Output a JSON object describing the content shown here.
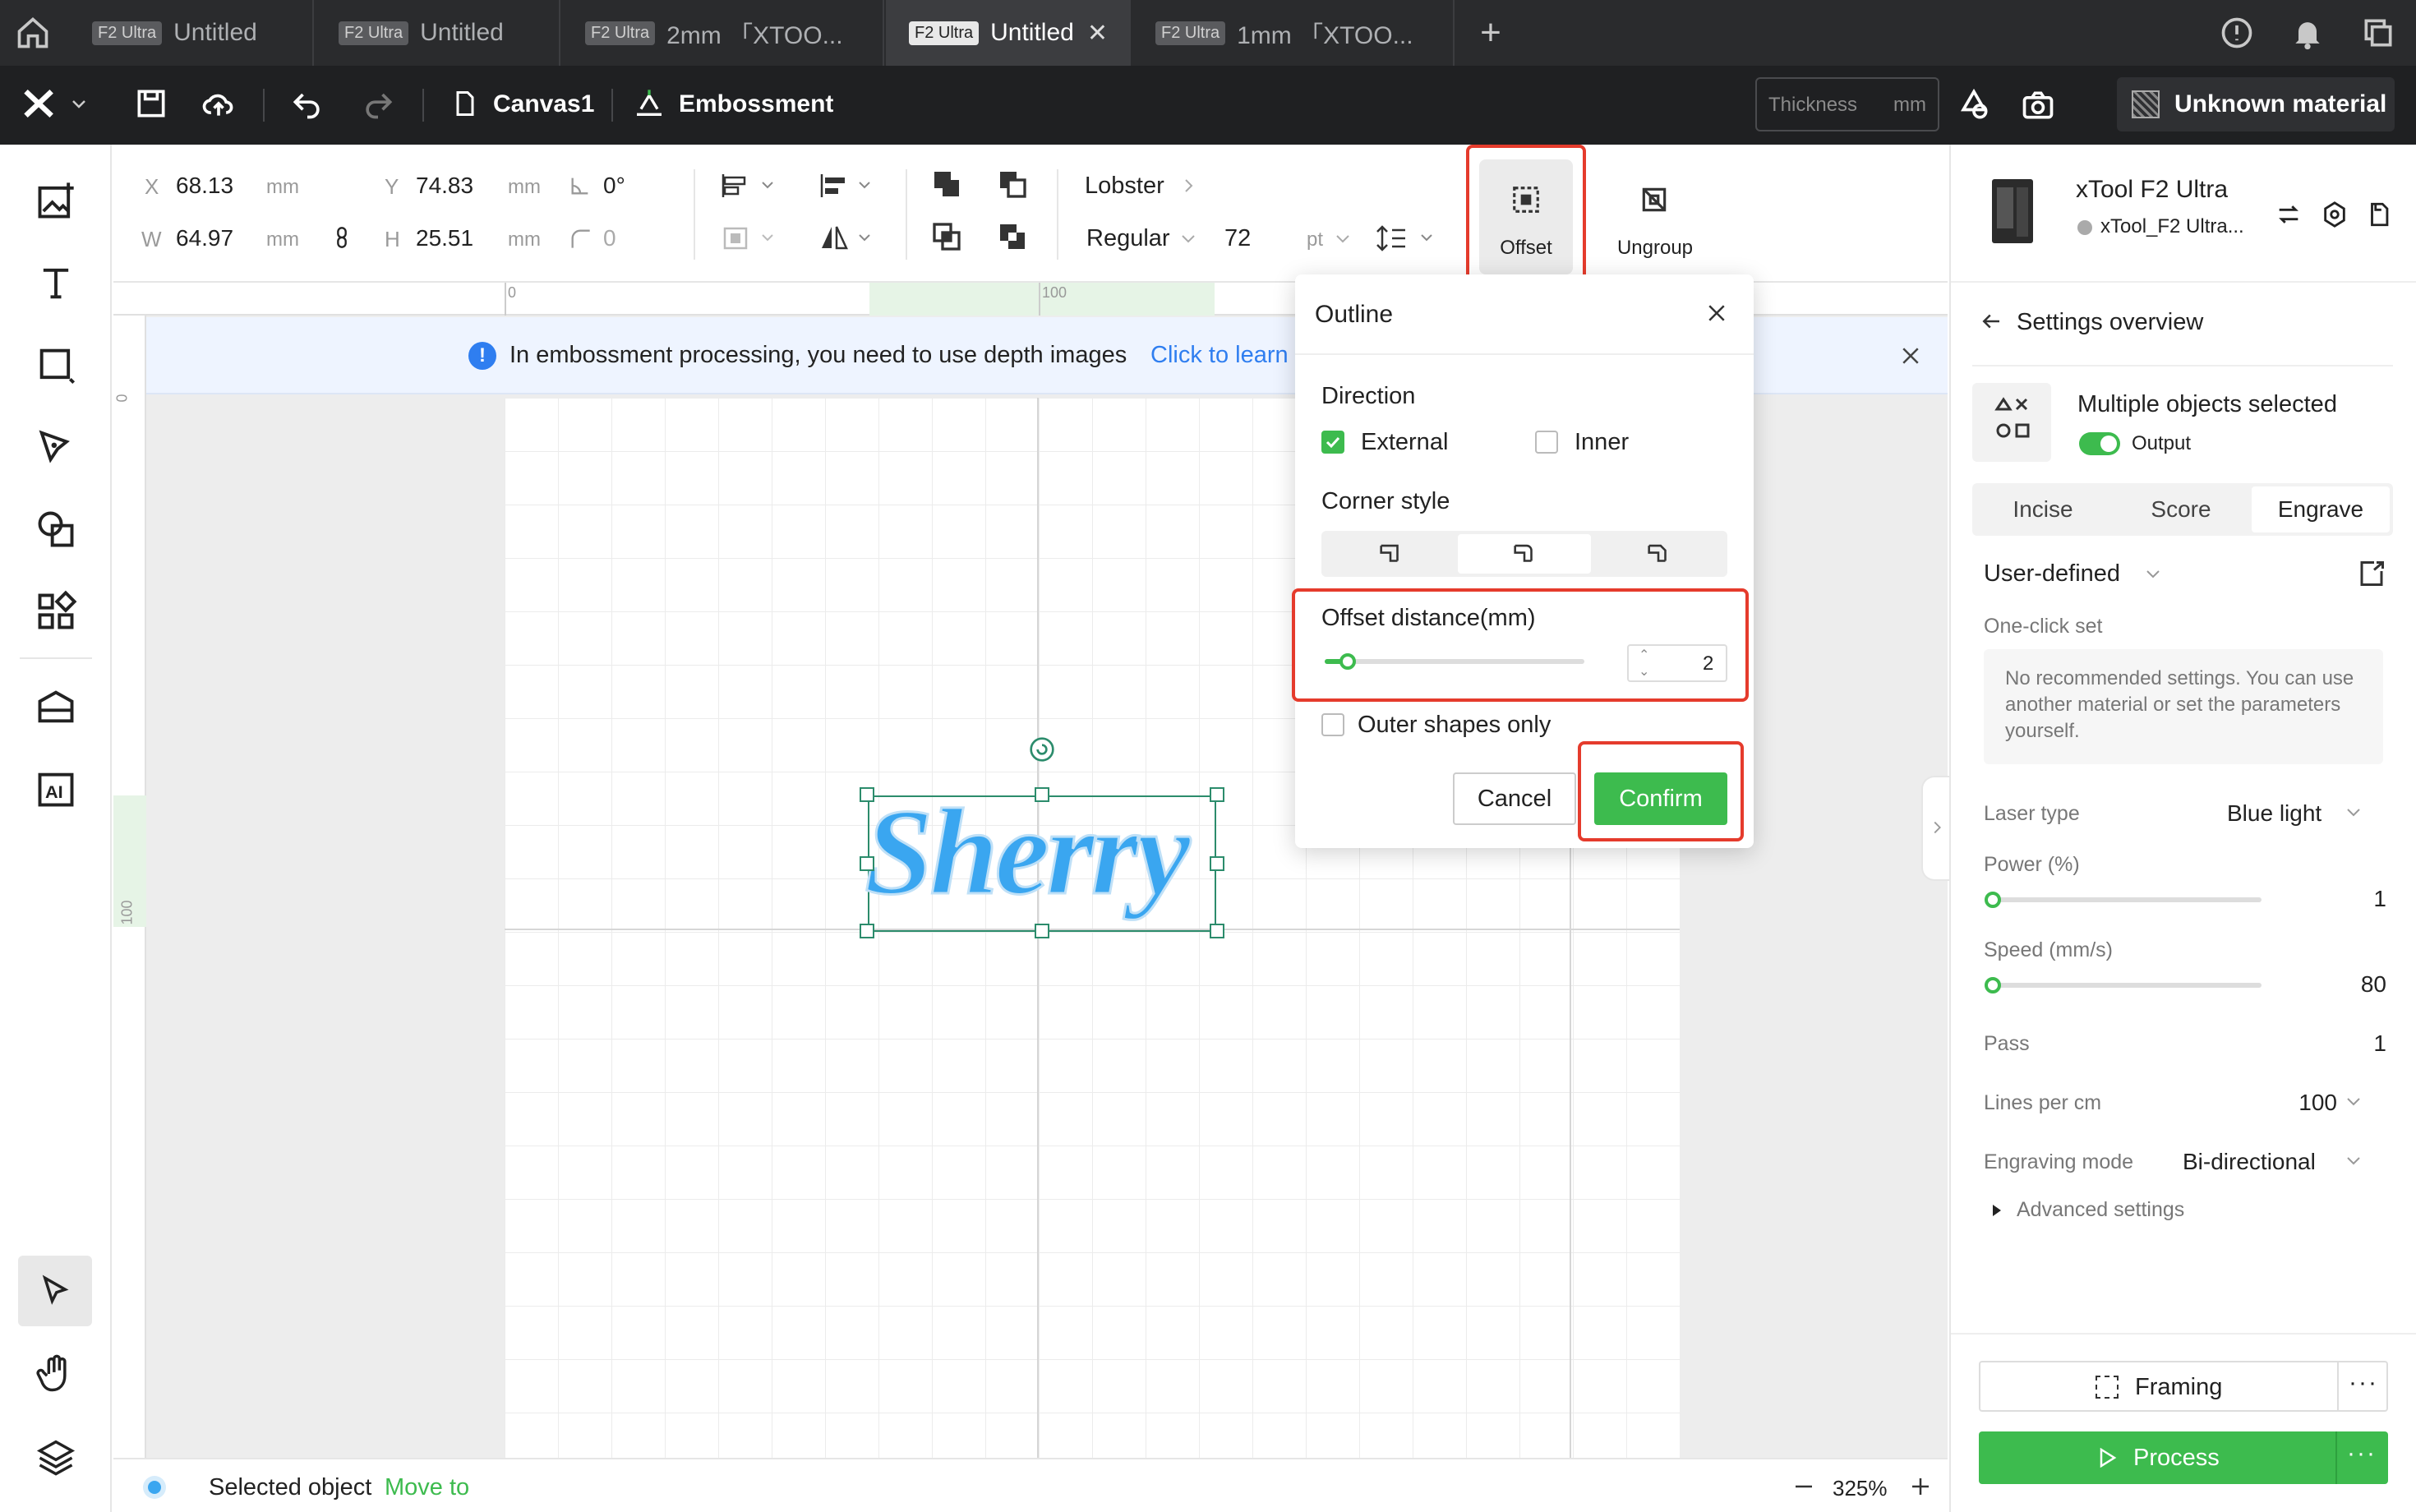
{
  "tabs": [
    {
      "badge": "F2 Ultra",
      "title": "Untitled"
    },
    {
      "badge": "F2 Ultra",
      "title": "Untitled"
    },
    {
      "badge": "F2 Ultra",
      "title": "2mm 「XTOO..."
    },
    {
      "badge": "F2 Ultra",
      "title": "Untitled"
    },
    {
      "badge": "F2 Ultra",
      "title": "1mm 「XTOO..."
    }
  ],
  "toolbar": {
    "canvas_name": "Canvas1",
    "mode": "Embossment",
    "thickness_placeholder": "Thickness",
    "thickness_unit": "mm",
    "material": "Unknown material"
  },
  "props": {
    "x_label": "X",
    "x": "68.13",
    "y_label": "Y",
    "y": "74.83",
    "w_label": "W",
    "w": "64.97",
    "h_label": "H",
    "h": "25.51",
    "unit": "mm",
    "rotation": "0°",
    "radius": "0",
    "font": "Lobster",
    "style": "Regular",
    "size": "72",
    "size_unit": "pt",
    "offset_label": "Offset",
    "ungroup_label": "Ungroup"
  },
  "ruler": {
    "top_0": "0",
    "top_100": "100",
    "left_0": "0",
    "left_100": "100"
  },
  "banner": {
    "text": "In embossment processing, you need to use depth images",
    "link": "Click to learn"
  },
  "canvas": {
    "text": "Sherry"
  },
  "dialog": {
    "title": "Outline",
    "direction_label": "Direction",
    "external": "External",
    "inner": "Inner",
    "external_checked": true,
    "inner_checked": false,
    "corner_label": "Corner style",
    "offset_label": "Offset distance(mm)",
    "offset_value": "2",
    "offset_fraction": 0.09,
    "outer_only": "Outer shapes only",
    "cancel": "Cancel",
    "confirm": "Confirm"
  },
  "status": {
    "selected": "Selected object",
    "move": "Move to",
    "zoom": "325%"
  },
  "right": {
    "device": "xTool F2 Ultra",
    "device_sub": "xTool_F2 Ultra...",
    "overview": "Settings overview",
    "multi": "Multiple objects selected",
    "output": "Output",
    "tabs": [
      "Incise",
      "Score",
      "Engrave"
    ],
    "active_tab": "Engrave",
    "preset": "User-defined",
    "one_click": "One-click set",
    "rec_text": "No recommended settings. You can use another material or set the parameters yourself.",
    "laser_label": "Laser type",
    "laser": "Blue light",
    "power_label": "Power (%)",
    "power": "1",
    "power_fraction": 0.01,
    "speed_label": "Speed (mm/s)",
    "speed": "80",
    "speed_fraction": 0.01,
    "pass_label": "Pass",
    "pass": "1",
    "lines_label": "Lines per cm",
    "lines": "100",
    "mode_label": "Engraving mode",
    "mode": "Bi-directional",
    "advanced": "Advanced settings",
    "framing": "Framing",
    "process": "Process"
  },
  "colors": {
    "accent_green": "#3dbb4e",
    "highlight_red": "#e53b2c",
    "link_blue": "#2f7ef0",
    "text_blue": "#3aa6f0"
  }
}
